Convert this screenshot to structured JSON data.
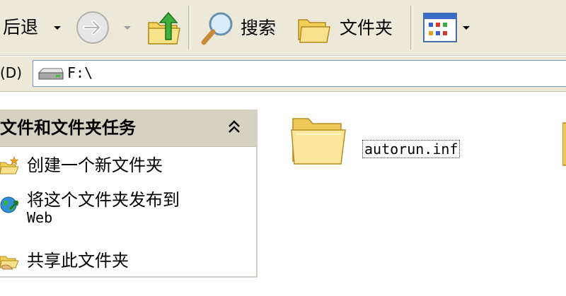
{
  "toolbar": {
    "back_label": "后退",
    "search_label": "搜索",
    "folders_label": "文件夹",
    "icons": {
      "back_arrow": "dropdown-arrow",
      "forward": "forward-arrow-icon",
      "up": "up-folder-icon",
      "search": "magnifier-icon",
      "folders": "folders-icon",
      "views": "views-icon"
    }
  },
  "address": {
    "label": "(D)",
    "value": "F:\\",
    "drive_icon": "drive-icon"
  },
  "tasks": {
    "title": "文件和文件夹任务",
    "collapse_icon": "chevron-up-icon",
    "items": [
      {
        "label": "创建一个新文件夹",
        "icon": "new-folder-icon"
      },
      {
        "label": "将这个文件夹发布到",
        "label_line2": "Web",
        "icon": "publish-web-icon"
      },
      {
        "label": "共享此文件夹",
        "icon": "share-folder-icon"
      }
    ]
  },
  "files": [
    {
      "name": "autorun.inf",
      "icon": "folder-icon"
    }
  ],
  "colors": {
    "toolbar_bg": "#ece9d8",
    "task_header_bg": "#d6d2c2",
    "address_border": "#7f9db9"
  }
}
